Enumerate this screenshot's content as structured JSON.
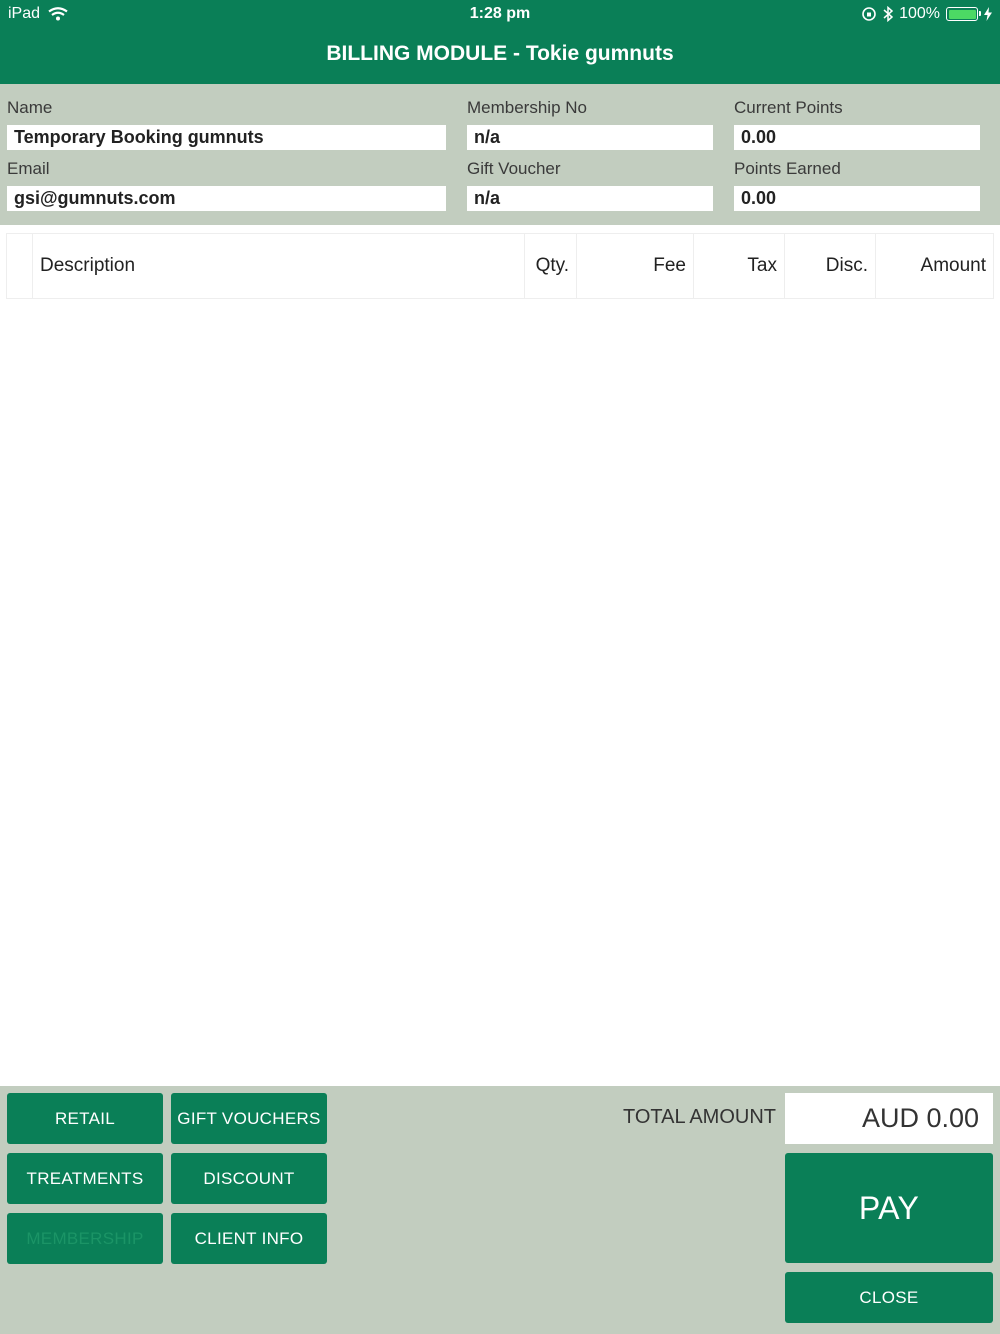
{
  "status_bar": {
    "device": "iPad",
    "time": "1:28 pm",
    "battery_text": "100%"
  },
  "header": {
    "title": "BILLING MODULE - Tokie gumnuts"
  },
  "client": {
    "name_label": "Name",
    "name_value": "Temporary Booking gumnuts",
    "membership_label": "Membership No",
    "membership_value": "n/a",
    "current_points_label": "Current Points",
    "current_points_value": "0.00",
    "email_label": "Email",
    "email_value": "gsi@gumnuts.com",
    "gift_voucher_label": "Gift Voucher",
    "gift_voucher_value": "n/a",
    "points_earned_label": "Points Earned",
    "points_earned_value": "0.00"
  },
  "table": {
    "columns": [
      "Description",
      "Qty.",
      "Fee",
      "Tax",
      "Disc.",
      "Amount"
    ],
    "rows": []
  },
  "actions": {
    "retail": "RETAIL",
    "gift_vouchers": "GIFT VOUCHERS",
    "treatments": "TREATMENTS",
    "discount": "DISCOUNT",
    "membership": "MEMBERSHIP",
    "client_info": "CLIENT INFO",
    "pay": "PAY",
    "close": "CLOSE"
  },
  "totals": {
    "label": "TOTAL AMOUNT",
    "value": "AUD 0.00"
  },
  "colors": {
    "primary": "#0a7f57",
    "panel": "#c2cdbf",
    "battery": "#4cd964"
  }
}
